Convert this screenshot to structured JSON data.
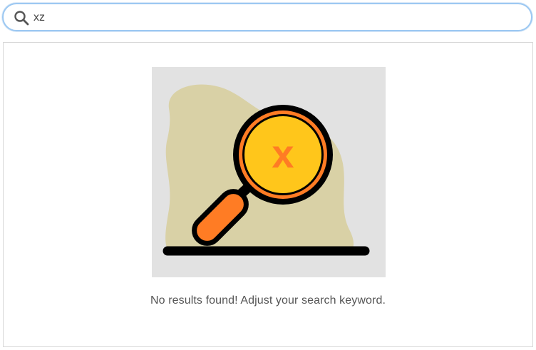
{
  "search": {
    "value": "xz",
    "icon": "search-icon"
  },
  "results": {
    "empty_message": "No results found! Adjust your search keyword.",
    "illustration": {
      "icon": "no-results-magnifier-icon",
      "mark": "x",
      "colors": {
        "background": "#e2e2e2",
        "blob": "#d9d1a6",
        "lens": "#ffc61b",
        "accent": "#ff7c24",
        "outline": "#000000"
      }
    }
  }
}
